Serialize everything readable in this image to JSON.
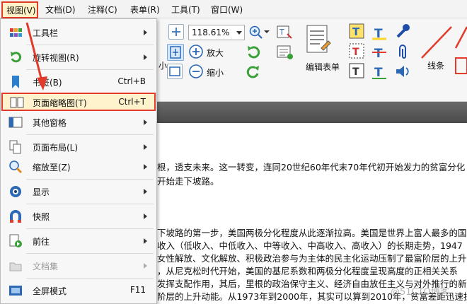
{
  "menubar": {
    "items": [
      "视图(V)",
      "文档(D)",
      "注释(C)",
      "表单(R)",
      "工具(T)",
      "窗口(W)"
    ]
  },
  "toolbar": {
    "zoom_value": "118.61%",
    "fit_width_label": "放大",
    "zoom_out_label": "缩小",
    "small_label": "小",
    "edit_form_label": "编辑表单",
    "line_label": "线条"
  },
  "document": {
    "lines": [
      "根，透支未来。这一转变，连同20世纪60年代末70年代初开始发力的贫富分化",
      "开始走下坡路。",
      "下坡路的第一步，美国两极分化程度从此逐渐拉高。美国是世界上富人最多的国",
      "收入（低收入、中低收入、中等收入、中高收入、高收入）的长期走势，1947",
      "女性解放、文化解放、积极政治参与为主体的民主化运动压制了最富阶层的上升",
      "，从尼克松时代开始，美国的基尼系数和两极分化程度呈现高度的正相关关系",
      "发挥支配作用，其后，里根的政治保守主义、经济自由放任主义与对外推行的新",
      "阶层的上升动能。从1973年到2000年，其实可以算到2010年，贫富差距迅速拉"
    ]
  },
  "menu": {
    "items": [
      {
        "label": "工具栏",
        "shortcut": "",
        "submenu": true,
        "disabled": false
      },
      {
        "label": "旋转视图(R)",
        "shortcut": "",
        "submenu": true,
        "disabled": false
      },
      {
        "label": "书签(B)",
        "shortcut": "Ctrl+B",
        "submenu": false,
        "disabled": false
      },
      {
        "label": "页面缩略图(T)",
        "shortcut": "Ctrl+T",
        "submenu": false,
        "disabled": false
      },
      {
        "label": "其他窗格",
        "shortcut": "",
        "submenu": true,
        "disabled": false
      },
      {
        "label": "页面布局(L)",
        "shortcut": "",
        "submenu": true,
        "disabled": false
      },
      {
        "label": "缩放至(Z)",
        "shortcut": "",
        "submenu": true,
        "disabled": false
      },
      {
        "label": "显示",
        "shortcut": "",
        "submenu": true,
        "disabled": false
      },
      {
        "label": "快照",
        "shortcut": "",
        "submenu": true,
        "disabled": false
      },
      {
        "label": "前往",
        "shortcut": "",
        "submenu": true,
        "disabled": false
      },
      {
        "label": "文档集",
        "shortcut": "",
        "submenu": true,
        "disabled": true
      },
      {
        "label": "全屏模式",
        "shortcut": "F11",
        "submenu": false,
        "disabled": false
      }
    ]
  },
  "watermark": "@51CTO博客",
  "colors": {
    "highlight_border": "#e23b2b",
    "highlight_fill": "#fff3cd",
    "arrow": "#e23b2b"
  }
}
